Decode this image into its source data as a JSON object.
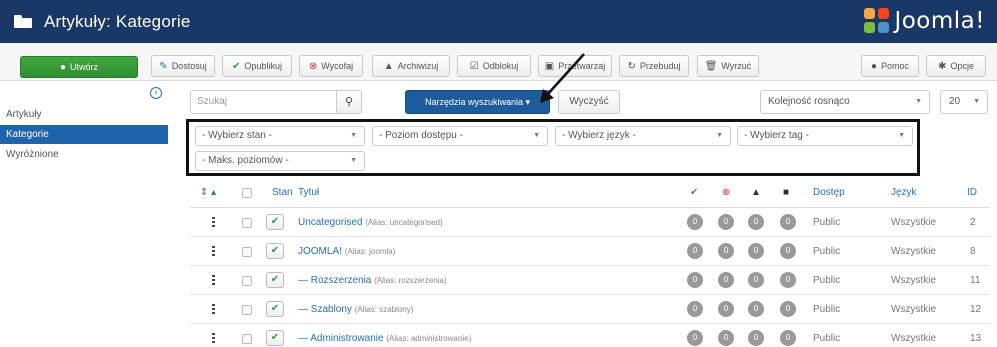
{
  "header": {
    "title": "Artykuły: Kategorie",
    "brand": "Joomla!"
  },
  "toolbar": {
    "new": "Utwórz",
    "edit": "Dostosuj",
    "publish": "Opublikuj",
    "unpublish": "Wycofaj",
    "archive": "Archiwizuj",
    "checkin": "Odblokuj",
    "batch": "Przetwarzaj",
    "rebuild": "Przebuduj",
    "trash": "Wyrzuć",
    "help": "Pomoc",
    "options": "Opcje"
  },
  "sidebar": {
    "items": [
      "Artykuły",
      "Kategorie",
      "Wyróżnione"
    ]
  },
  "search": {
    "placeholder": "Szukaj",
    "tools_label": "Narzędzia wyszukiwania",
    "clear_label": "Wyczyść"
  },
  "ordering": {
    "order": "Kolejność rosnąco",
    "limit": "20"
  },
  "filters": {
    "state": "- Wybierz stan -",
    "access": "- Poziom dostępu -",
    "language": "- Wybierz język -",
    "tag": "- Wybierz tag -",
    "max_levels": "- Maks. poziomów -"
  },
  "table": {
    "headers": {
      "status": "Stan",
      "title": "Tytuł",
      "access": "Dostęp",
      "language": "Język",
      "id": "ID"
    },
    "rows": [
      {
        "title": "Uncategorised",
        "alias": "(Alias: uncategorised)",
        "access": "Public",
        "language": "Wszystkie",
        "id": "2",
        "counts": [
          "0",
          "0",
          "0",
          "0"
        ]
      },
      {
        "title": "JOOMLA!",
        "alias": "(Alias: joomla)",
        "access": "Public",
        "language": "Wszystkie",
        "id": "8",
        "counts": [
          "0",
          "0",
          "0",
          "0"
        ]
      },
      {
        "title": "— Rozszerzenia",
        "alias": "(Alias: rozszerzenia)",
        "access": "Public",
        "language": "Wszystkie",
        "id": "11",
        "counts": [
          "0",
          "0",
          "0",
          "0"
        ]
      },
      {
        "title": "— Szablony",
        "alias": "(Alias: szablony)",
        "access": "Public",
        "language": "Wszystkie",
        "id": "12",
        "counts": [
          "0",
          "0",
          "0",
          "0"
        ]
      },
      {
        "title": "— Administrowanie",
        "alias": "(Alias: administrowanie)",
        "access": "Public",
        "language": "Wszystkie",
        "id": "13",
        "counts": [
          "0",
          "0",
          "0",
          "0"
        ]
      }
    ]
  },
  "colors": {
    "header_bg": "#1a3867",
    "accent": "#1f63ad",
    "new_button": "#3a9e3a"
  }
}
